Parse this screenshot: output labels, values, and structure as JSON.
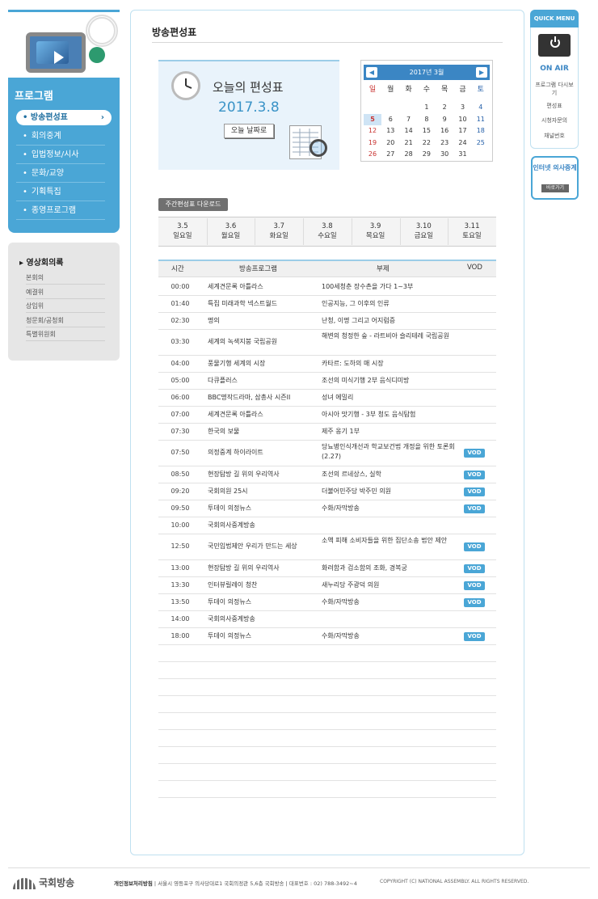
{
  "page_title": "방송편성표",
  "sidebar": {
    "program_title": "프로그램",
    "active_item": "방송편성표",
    "items": [
      "회의중계",
      "입법정보/시사",
      "문화/교양",
      "기획특집",
      "종영프로그램"
    ],
    "video_title": "▸ 영상회의록",
    "video_items": [
      "본회의",
      "예결위",
      "상임위",
      "청문회/공청회",
      "특별위원회"
    ]
  },
  "today": {
    "label": "오늘의 편성표",
    "date": "2017.3.8",
    "button": "오늘 날짜로"
  },
  "calendar": {
    "month": "2017년 3월",
    "prev": "◀",
    "next": "▶",
    "dow": [
      "일",
      "월",
      "화",
      "수",
      "목",
      "금",
      "토"
    ],
    "weeks": [
      [
        "",
        "",
        "",
        "1",
        "2",
        "3",
        "4"
      ],
      [
        "5",
        "6",
        "7",
        "8",
        "9",
        "10",
        "11"
      ],
      [
        "12",
        "13",
        "14",
        "15",
        "16",
        "17",
        "18"
      ],
      [
        "19",
        "20",
        "21",
        "22",
        "23",
        "24",
        "25"
      ],
      [
        "26",
        "27",
        "28",
        "29",
        "30",
        "31",
        ""
      ]
    ],
    "highlight": "5"
  },
  "download_button": "주간편성표 다운로드",
  "days": [
    {
      "date": "3.5",
      "dow": "일요일"
    },
    {
      "date": "3.6",
      "dow": "월요일"
    },
    {
      "date": "3.7",
      "dow": "화요일"
    },
    {
      "date": "3.8",
      "dow": "수요일"
    },
    {
      "date": "3.9",
      "dow": "목요일"
    },
    {
      "date": "3.10",
      "dow": "금요일"
    },
    {
      "date": "3.11",
      "dow": "토요일"
    }
  ],
  "schedule_head": {
    "time": "시간",
    "program": "방송프로그램",
    "subtitle": "부제",
    "vod": "VOD"
  },
  "schedule": [
    {
      "time": "00:00",
      "program": "세계견문록 아틀라스",
      "subtitle": "100세청춘 장수촌을 가다 1~3부",
      "vod": ""
    },
    {
      "time": "01:40",
      "program": "특집 미래과학 넥스트월드",
      "subtitle": "인공지능, 그 이후의 인류",
      "vod": ""
    },
    {
      "time": "02:30",
      "program": "명의",
      "subtitle": "난청, 이명 그리고 어지럼증",
      "vod": ""
    },
    {
      "time": "03:30",
      "program": "세계의 녹색지붕 국립공원",
      "subtitle": "해변의 청정한 숲 - 라트비아 슬리테레 국립공원",
      "vod": ""
    },
    {
      "time": "04:00",
      "program": "풍물기행 세계의 시장",
      "subtitle": "카타르: 도하의 매 시장",
      "vod": ""
    },
    {
      "time": "05:00",
      "program": "다큐플러스",
      "subtitle": "조선의 미식기행 2부 음식디미방",
      "vod": ""
    },
    {
      "time": "06:00",
      "program": "BBC명작드라마, 삼총사 시즌II",
      "subtitle": "성녀 에밀리",
      "vod": ""
    },
    {
      "time": "07:00",
      "program": "세계견문록 아틀라스",
      "subtitle": "아시아 맛기행 - 3부 청도 음식탐험",
      "vod": ""
    },
    {
      "time": "07:30",
      "program": "한국의 보물",
      "subtitle": "제주 옹기 1부",
      "vod": ""
    },
    {
      "time": "07:50",
      "program": "의정중계 하이라이트",
      "subtitle": "당뇨병인식개선과 학교보건법 개정을 위한 토론회(2.27)",
      "vod": "VOD"
    },
    {
      "time": "08:50",
      "program": "현장탐방 길 위의 우리역사",
      "subtitle": "조선의 르네상스, 실학",
      "vod": "VOD"
    },
    {
      "time": "09:20",
      "program": "국회의원 25시",
      "subtitle": "더불어민주당 박주민 의원",
      "vod": "VOD"
    },
    {
      "time": "09:50",
      "program": "투데이 의정뉴스",
      "subtitle": "수화/자막방송",
      "vod": "VOD"
    },
    {
      "time": "10:00",
      "program": "국회의사중계방송",
      "subtitle": "",
      "vod": ""
    },
    {
      "time": "12:50",
      "program": "국민입법제안 우리가 만드는 세상",
      "subtitle": "소액 피해 소비자들을 위한 집단소송 법안 제안",
      "vod": "VOD"
    },
    {
      "time": "13:00",
      "program": "현장탐방 길 위의 우리역사",
      "subtitle": "화려함과 검소함의 조화, 경복궁",
      "vod": "VOD"
    },
    {
      "time": "13:30",
      "program": "인터뷰릴레이 청찬",
      "subtitle": "새누리당 주광덕 의원",
      "vod": "VOD"
    },
    {
      "time": "13:50",
      "program": "투데이 의정뉴스",
      "subtitle": "수화/자막방송",
      "vod": "VOD"
    },
    {
      "time": "14:00",
      "program": "국회의사중계방송",
      "subtitle": "",
      "vod": ""
    },
    {
      "time": "18:00",
      "program": "투데이 의정뉴스",
      "subtitle": "수화/자막방송",
      "vod": "VOD"
    }
  ],
  "quick_menu": {
    "title": "QUICK MENU",
    "onair": "ON AIR",
    "items": [
      "프로그램 다시보기",
      "편성표",
      "시청자문의",
      "채널번호"
    ]
  },
  "internet": {
    "label": "인터넷 의사중계",
    "button": "바로가기"
  },
  "footer": {
    "logo": "국회방송",
    "privacy": "개인정보처리방침",
    "address": "서울시 영등포구 의사당대로1 국회의정관 5,6층 국회방송 | 대표번호 : 02) 788-3492~4",
    "copyright": "COPYRIGHT (C) NATIONAL ASSEMBLY. ALL RIGHTS RESERVED."
  },
  "colors": {
    "accent": "#4aa6d6",
    "vod_badge": "#4aa6d6",
    "calendar_head": "#3b86c4",
    "sunday": "#c8312f",
    "saturday": "#245fa8"
  }
}
